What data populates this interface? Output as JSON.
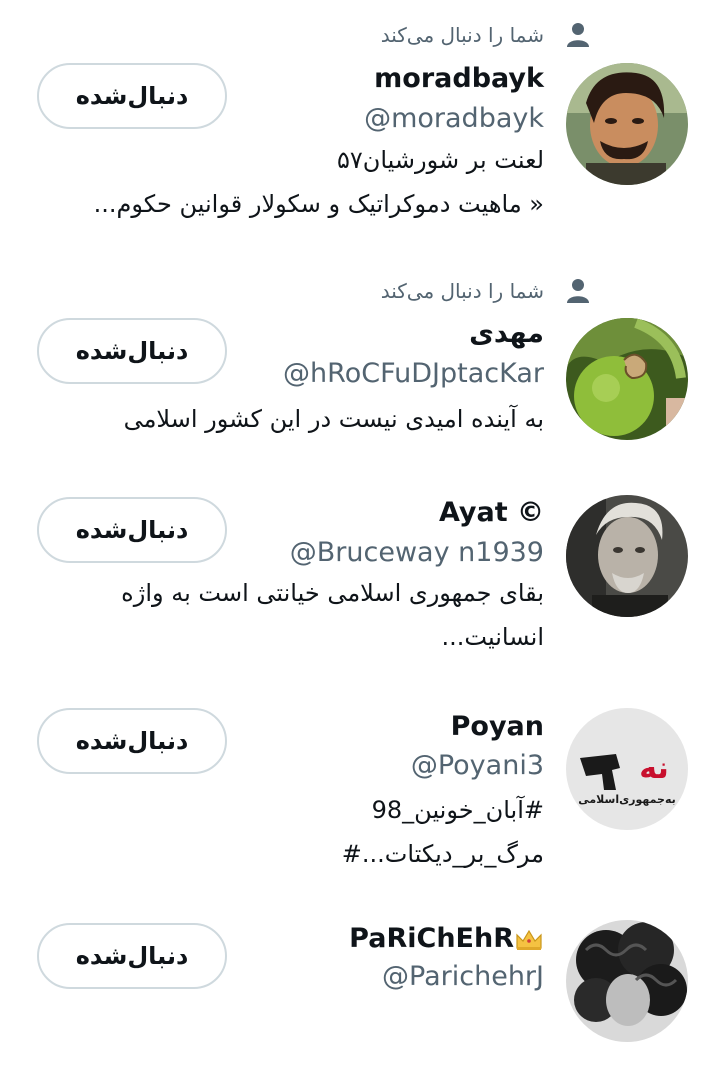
{
  "follows_you_label": "شما را دنبال می‌کند",
  "following_button_label": "دنبال‌شده",
  "users": [
    {
      "name": "moradbayk",
      "handle": "@moradbayk",
      "bio": [
        "لعنت بر شورشیان۵۷",
        "« ماهیت دموکراتیک و سکولار قوانین حکوم..."
      ],
      "follows_you": true,
      "avatar": "portrait-mustache-man"
    },
    {
      "name": "مهدی",
      "handle": "@hRoCFuDJptacKar",
      "bio": [
        "به آینده امیدی نیست در این کشور اسلامی"
      ],
      "follows_you": true,
      "avatar": "snail-on-lime"
    },
    {
      "name": "Ayat ©",
      "handle": "@Bruceway n1939",
      "bio": [
        "بقای جمهوری اسلامی خیانتی است به واژه",
        "انسانیت..."
      ],
      "follows_you": false,
      "avatar": "grey-haired-man"
    },
    {
      "name": "Poyan",
      "handle": "@Poyani3",
      "bio": [
        "#آبان_خونین_98",
        "مرگ_بر_دیکتات...#"
      ],
      "follows_you": false,
      "avatar": "na-be-jomhouri-eslami-logo",
      "avatar_text": [
        "نه",
        "به‌جمهوری‌اسلامی"
      ]
    },
    {
      "name": "PaRiChEhR",
      "handle": "@ParichehrJ",
      "bio": [],
      "follows_you": false,
      "avatar": "curly-hair-bw-photo",
      "name_emoji": "crown-icon"
    }
  ],
  "colors": {
    "text": "#0f1419",
    "secondary": "#536471",
    "button_border": "#cfd9de",
    "logo_red": "#c8102e"
  }
}
